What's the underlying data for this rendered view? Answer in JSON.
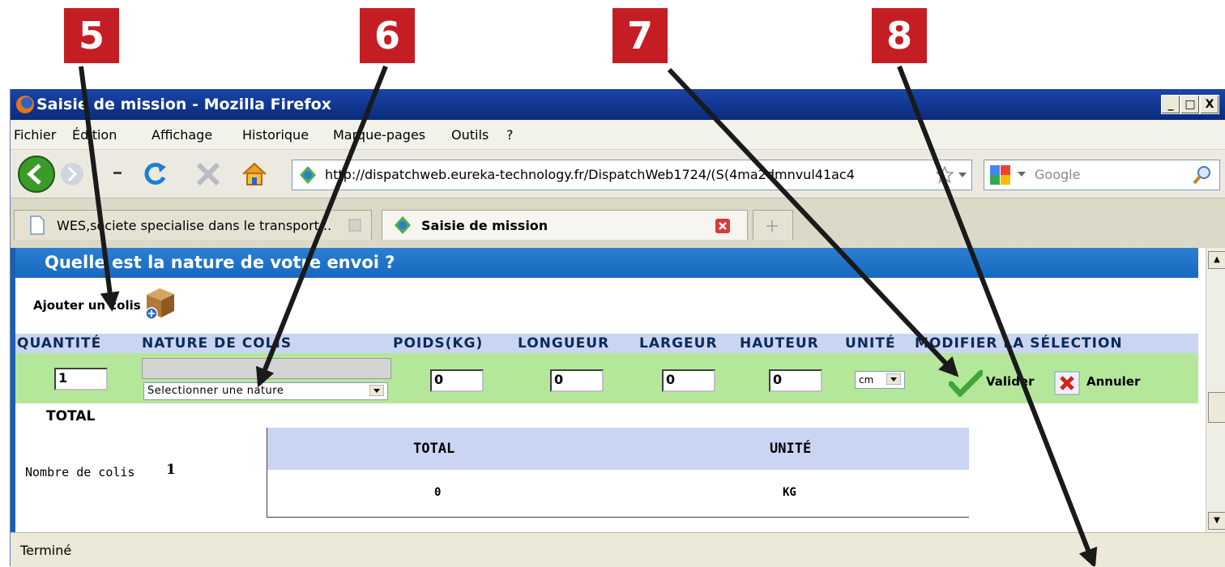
{
  "callouts": [
    "5",
    "6",
    "7",
    "8"
  ],
  "window": {
    "title": "Saisie de mission - Mozilla Firefox",
    "controls": [
      "_",
      "□",
      "X"
    ]
  },
  "menu": [
    "Fichier",
    "Édition",
    "Affichage",
    "Historique",
    "Marque-pages",
    "Outils",
    "?"
  ],
  "nav": {
    "url": "http://dispatchweb.eureka-technology.fr/DispatchWeb1724/(S(4ma2dmnvul41ac4",
    "search_placeholder": "Google"
  },
  "tabs": [
    {
      "label": "WES,societe specialise dans le transport...",
      "active": false
    },
    {
      "label": "Saisie de mission",
      "active": true
    }
  ],
  "page": {
    "heading": "Quelle est la nature de votre envoi ?",
    "add_colis": "Ajouter un colis",
    "columns": [
      "QUANTITÉ",
      "NATURE DE COLIS",
      "POIDS(KG)",
      "LONGUEUR",
      "LARGEUR",
      "HAUTEUR",
      "UNITÉ",
      "MODIFIER LA SÉLECTION"
    ],
    "row": {
      "quantite": "1",
      "nature_placeholder": "Selectionner une nature",
      "poids": "0",
      "longueur": "0",
      "largeur": "0",
      "hauteur": "0",
      "unite": "cm",
      "valider": "Valider",
      "annuler": "Annuler"
    },
    "total_label": "TOTAL",
    "nombre_colis_label": "Nombre de colis",
    "nombre_colis_value": "1",
    "total_table": {
      "headers": [
        "TOTAL",
        "UNITÉ"
      ],
      "values": [
        "0",
        "KG"
      ]
    }
  },
  "status": "Terminé",
  "colors": {
    "callout": "#c41e24",
    "titlebar": "#0a2a7c",
    "header_band": "#1769c0",
    "input_row": "#b4e79a",
    "col_header": "#c9d5f2"
  }
}
